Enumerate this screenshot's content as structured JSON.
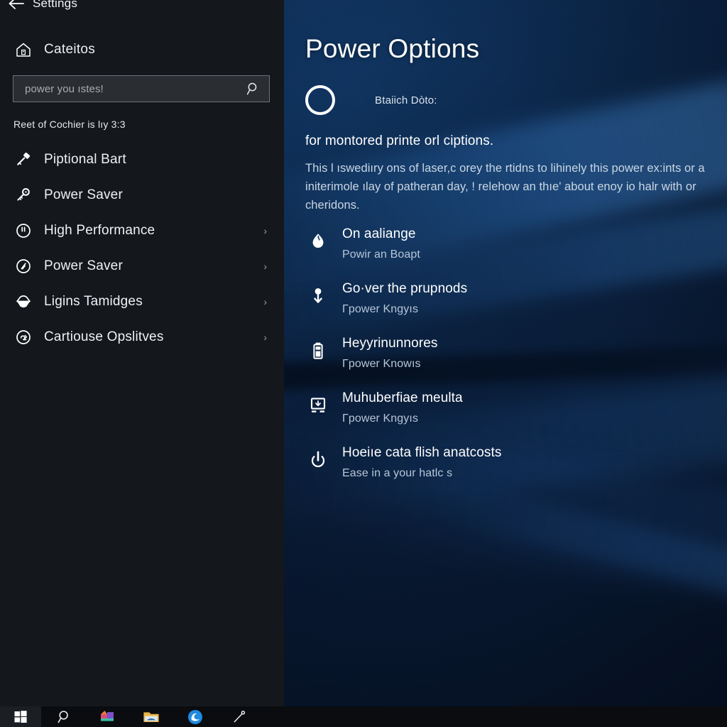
{
  "window": {
    "app_title": "Settings",
    "back_icon": "back-arrow-icon"
  },
  "sidebar": {
    "home": {
      "label": "Cateitos",
      "icon": "home-icon"
    },
    "search": {
      "placeholder": "power you ıstes!",
      "value": "",
      "icon": "search-icon"
    },
    "section_caption": "Reet of Cochier is lıy 3:3",
    "items": [
      {
        "label": "Piptional Bart",
        "icon": "battery-key-icon",
        "chevron": ""
      },
      {
        "label": "Power Saver",
        "icon": "key-icon",
        "chevron": ""
      },
      {
        "label": "High Performance",
        "icon": "clock-circle-icon",
        "chevron": "›"
      },
      {
        "label": "Power Saver",
        "icon": "clock-slash-icon",
        "chevron": "›"
      },
      {
        "label": "Ligins Tamidges",
        "icon": "eye-display-icon",
        "chevron": "›"
      },
      {
        "label": "Cartiouse Opslitves",
        "icon": "power-circle-icon",
        "chevron": "›"
      }
    ]
  },
  "panel": {
    "title": "Power Options",
    "status": {
      "ring_icon": "ring-status-icon",
      "text": "Btaiich Dòto:"
    },
    "subhead": "for montored printe orl ciptions.",
    "paragraph": "This l ıswediıry ons of laser,c orey the rtidns to lihinely this power ex:ints or a initerimole ılay of patheran day, ! relehow an thıe' about enoy io halr with or cheridons.",
    "options": [
      {
        "title": "On aaliange",
        "sub": "Powir an Boapt",
        "icon": "flame-drop-icon"
      },
      {
        "title": "Go·ver the prupnods",
        "sub": "Γpower Kngyıs",
        "icon": "pin-down-arrow-icon"
      },
      {
        "title": "Heyyrinunnores",
        "sub": "Γpower Knowıs",
        "icon": "battery-icon"
      },
      {
        "title": "Muhuberfiae meulta",
        "sub": "Γpower Kngyıs",
        "icon": "monitor-icon"
      },
      {
        "title": "Hoeiıe cata flish anatcosts",
        "sub": "Ease in a your hatlc s",
        "icon": "power-button-icon"
      }
    ]
  },
  "taskbar": {
    "start": {
      "label": "start-button",
      "icon": "windows-logo-icon"
    },
    "items": [
      {
        "icon": "search-circle-icon",
        "label": "search"
      },
      {
        "icon": "store-icon",
        "label": "microsoft-store"
      },
      {
        "icon": "file-explorer-icon",
        "label": "file-explorer"
      },
      {
        "icon": "edge-browser-icon",
        "label": "edge"
      },
      {
        "icon": "pen-tool-icon",
        "label": "pen"
      }
    ]
  },
  "colors": {
    "sidebar_bg": "#14181d",
    "panel_blue": "#0c2546",
    "accent_white": "#ffffff",
    "taskbar_bg": "#0a0c0f",
    "muted_text": "#b6c6d8"
  }
}
